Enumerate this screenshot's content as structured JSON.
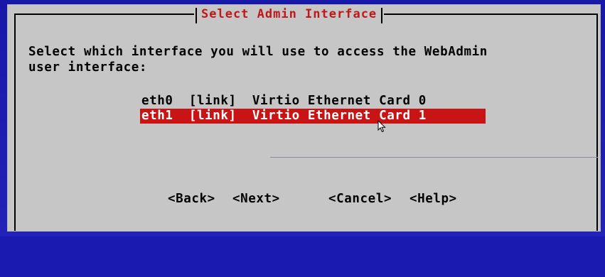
{
  "dialog": {
    "title": "Select Admin Interface",
    "prompt": "Select which interface you will use to access the WebAdmin\nuser interface:"
  },
  "interfaces": [
    {
      "label": "eth0  [link]  Virtio Ethernet Card 0",
      "selected": false
    },
    {
      "label": "eth1  [link]  Virtio Ethernet Card 1",
      "selected": true
    }
  ],
  "buttons": {
    "back": "<Back>",
    "next": "<Next>",
    "cancel": "<Cancel>",
    "help": "<Help>"
  },
  "colors": {
    "background": "#1a1ab0",
    "dialog": "#c6c6c6",
    "title": "#c01818",
    "selection": "#c81414"
  },
  "icons": {
    "pointer": "mouse-pointer-icon"
  }
}
